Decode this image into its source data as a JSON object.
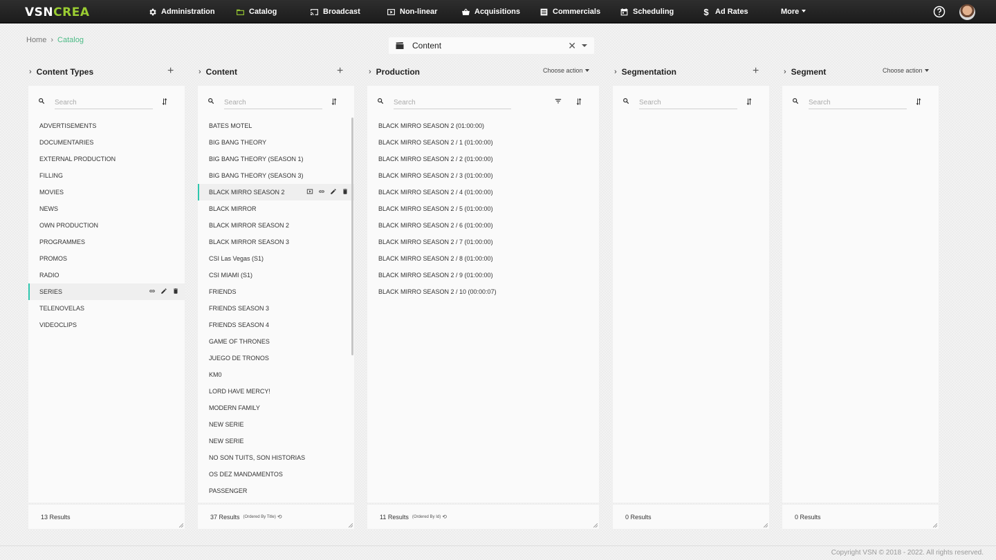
{
  "app": {
    "logo_main": "VSN",
    "logo_accent": "CREA",
    "nav": [
      {
        "label": "Administration",
        "icon": "gear-icon"
      },
      {
        "label": "Catalog",
        "icon": "folder-icon"
      },
      {
        "label": "Broadcast",
        "icon": "cast-icon"
      },
      {
        "label": "Non-linear",
        "icon": "play-box-icon"
      },
      {
        "label": "Acquisitions",
        "icon": "basket-icon"
      },
      {
        "label": "Commercials",
        "icon": "list-box-icon"
      },
      {
        "label": "Scheduling",
        "icon": "calendar-icon"
      },
      {
        "label": "Ad Rates",
        "icon": "dollar-icon"
      },
      {
        "label": "More",
        "icon": "chevron-down-icon"
      }
    ]
  },
  "breadcrumb": {
    "home": "Home",
    "current": "Catalog"
  },
  "selector": {
    "value": "Content"
  },
  "columns": {
    "content_types": {
      "title": "Content Types",
      "search_placeholder": "Search",
      "items": [
        "ADVERTISEMENTS",
        "DOCUMENTARIES",
        "EXTERNAL PRODUCTION",
        "FILLING",
        "MOVIES",
        "NEWS",
        "OWN PRODUCTION",
        "PROGRAMMES",
        "PROMOS",
        "RADIO",
        "SERIES",
        "TELENOVELAS",
        "VIDEOCLIPS"
      ],
      "selected_index": 10,
      "results": "13 Results"
    },
    "content": {
      "title": "Content",
      "search_placeholder": "Search",
      "items": [
        "BATES MOTEL",
        "BIG BANG THEORY",
        "BIG BANG THEORY (SEASON 1)",
        "BIG BANG THEORY (SEASON 3)",
        "BLACK MIRRO SEASON 2",
        "BLACK MIRROR",
        "BLACK MIRROR SEASON 2",
        "BLACK MIRROR SEASON 3",
        "CSI Las Vegas (S1)",
        "CSI MIAMI (S1)",
        "FRIENDS",
        "FRIENDS SEASON 3",
        "FRIENDS SEASON 4",
        "GAME OF THRONES",
        "JUEGO DE TRONOS",
        "KM0",
        "LORD HAVE MERCY!",
        "MODERN FAMILY",
        "NEW SERIE",
        "NEW SERIE",
        "NO SON TUITS, SON HISTORIAS",
        "OS DEZ MANDAMENTOS",
        "PASSENGER"
      ],
      "selected_index": 4,
      "results": "37 Results",
      "ordered": "(Ordered By Title)"
    },
    "production": {
      "title": "Production",
      "action": "Choose action",
      "search_placeholder": "Search",
      "items": [
        "BLACK MIRRO SEASON 2 (01:00:00)",
        "BLACK MIRRO SEASON 2 / 1 (01:00:00)",
        "BLACK MIRRO SEASON 2 / 2 (01:00:00)",
        "BLACK MIRRO SEASON 2 / 3 (01:00:00)",
        "BLACK MIRRO SEASON 2 / 4 (01:00:00)",
        "BLACK MIRRO SEASON 2 / 5 (01:00:00)",
        "BLACK MIRRO SEASON 2 / 6 (01:00:00)",
        "BLACK MIRRO SEASON 2 / 7 (01:00:00)",
        "BLACK MIRRO SEASON 2 / 8 (01:00:00)",
        "BLACK MIRRO SEASON 2 / 9 (01:00:00)",
        "BLACK MIRRO SEASON 2 / 10 (00:00:07)"
      ],
      "results": "11 Results",
      "ordered": "(Ordered By Id)"
    },
    "segmentation": {
      "title": "Segmentation",
      "search_placeholder": "Search",
      "results": "0 Results"
    },
    "segment": {
      "title": "Segment",
      "action": "Choose action",
      "search_placeholder": "Search",
      "results": "0 Results"
    }
  },
  "footer": {
    "copyright": "Copyright VSN © 2018 - 2022. All rights reserved."
  },
  "colors": {
    "accent": "#4cbb86",
    "selected_bar": "#2ec7ae",
    "topbar": "#262626"
  }
}
